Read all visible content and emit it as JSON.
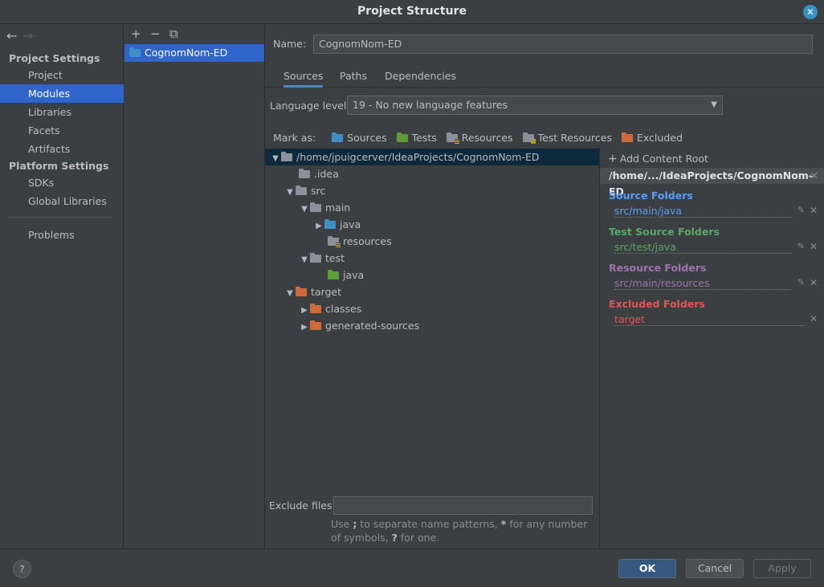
{
  "window": {
    "title": "Project Structure"
  },
  "sidebar": {
    "project_settings": "Project Settings",
    "platform_settings": "Platform Settings",
    "items": [
      {
        "label": "Project"
      },
      {
        "label": "Modules"
      },
      {
        "label": "Libraries"
      },
      {
        "label": "Facets"
      },
      {
        "label": "Artifacts"
      },
      {
        "label": "SDKs"
      },
      {
        "label": "Global Libraries"
      },
      {
        "label": "Problems"
      }
    ]
  },
  "modules": {
    "items": [
      {
        "label": "CognomNom-ED"
      }
    ]
  },
  "main": {
    "name_label": "Name:",
    "name_value": "CognomNom-ED",
    "tabs": [
      {
        "label": "Sources"
      },
      {
        "label": "Paths"
      },
      {
        "label": "Dependencies"
      }
    ],
    "language_label": "Language level:",
    "language_value": "19 - No new language features",
    "mark_as": {
      "label": "Mark as:",
      "options": [
        {
          "label": "Sources"
        },
        {
          "label": "Tests"
        },
        {
          "label": "Resources"
        },
        {
          "label": "Test Resources"
        },
        {
          "label": "Excluded"
        }
      ]
    },
    "tree": [
      {
        "label": "/home/jpuigcerver/IdeaProjects/CognomNom-ED"
      },
      {
        "label": ".idea"
      },
      {
        "label": "src"
      },
      {
        "label": "main"
      },
      {
        "label": "java"
      },
      {
        "label": "resources"
      },
      {
        "label": "test"
      },
      {
        "label": "java"
      },
      {
        "label": "target"
      },
      {
        "label": "classes"
      },
      {
        "label": "generated-sources"
      }
    ],
    "exclude_label": "Exclude files:",
    "exclude_value": "",
    "exclude_help_1": "Use ",
    "exclude_help_semi": ";",
    "exclude_help_2": " to separate name patterns, ",
    "exclude_help_star": "*",
    "exclude_help_3": " for any number of symbols, ",
    "exclude_help_q": "?",
    "exclude_help_4": " for one."
  },
  "content_root": {
    "add_label": "Add Content Root",
    "path": "/home/.../IdeaProjects/CognomNom-ED",
    "groups": [
      {
        "title": "Source Folders",
        "entry": "src/main/java",
        "color": "#589df6"
      },
      {
        "title": "Test Source Folders",
        "entry": "src/test/java",
        "color": "#59a869"
      },
      {
        "title": "Resource Folders",
        "entry": "src/main/resources",
        "color": "#9876aa"
      },
      {
        "title": "Excluded Folders",
        "entry": "target",
        "color": "#e05555"
      }
    ]
  },
  "buttons": {
    "ok": "OK",
    "cancel": "Cancel",
    "apply": "Apply",
    "help": "?"
  }
}
